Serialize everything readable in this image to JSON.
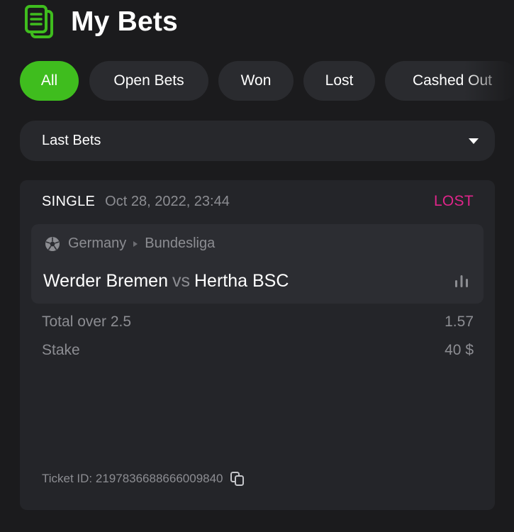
{
  "header": {
    "title": "My Bets",
    "icon": "bet-slip-icon",
    "accent_color": "#3fbd1e"
  },
  "filters": [
    {
      "label": "All",
      "active": true
    },
    {
      "label": "Open Bets",
      "active": false
    },
    {
      "label": "Won",
      "active": false
    },
    {
      "label": "Lost",
      "active": false
    },
    {
      "label": "Cashed Out",
      "active": false
    }
  ],
  "dropdown": {
    "selected": "Last Bets",
    "icon": "caret-down-icon"
  },
  "bet": {
    "type": "SINGLE",
    "date": "Oct 28, 2022, 23:44",
    "status": "LOST",
    "status_color": "#e0258a",
    "event": {
      "sport_icon": "soccer-ball-icon",
      "country": "Germany",
      "league": "Bundesliga",
      "home": "Werder Bremen",
      "vs": "vs",
      "away": "Hertha BSC",
      "stats_icon": "bar-chart-icon"
    },
    "selection": {
      "label": "Total over 2.5",
      "odds": "1.57"
    },
    "stake": {
      "label": "Stake",
      "value": "40 $"
    },
    "ticket": {
      "text": "Ticket ID: 2197836688666009840",
      "copy_icon": "copy-icon"
    }
  }
}
